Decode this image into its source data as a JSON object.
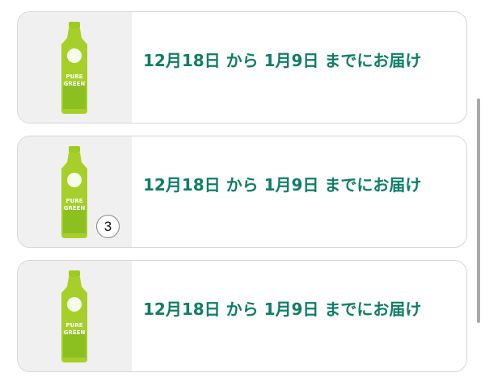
{
  "items": [
    {
      "delivery_text": "12月18日 から 1月9日 までにお届け",
      "quantity_badge": ""
    },
    {
      "delivery_text": "12月18日 から 1月9日 までにお届け",
      "quantity_badge": "3"
    },
    {
      "delivery_text": "12月18日 から 1月9日 までにお届け",
      "quantity_badge": ""
    }
  ],
  "product_label": {
    "line1": "PURE",
    "line2": "GREEN"
  },
  "colors": {
    "text": "#0f7e66",
    "bottle": "#a7cf2a",
    "thumb_bg": "#f0f0f0",
    "card_border": "#d6d6d6"
  }
}
